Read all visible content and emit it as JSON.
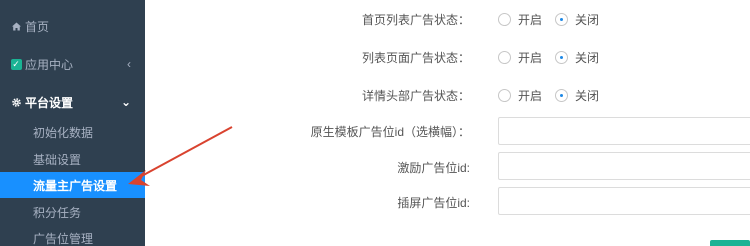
{
  "sidebar": {
    "home": "首页",
    "app_center": "应用中心",
    "platform_settings": "平台设置",
    "sub_items": [
      "初始化数据",
      "基础设置",
      "流量主广告设置",
      "积分任务",
      "广告位管理"
    ]
  },
  "form": {
    "rows": [
      {
        "label": "首页列表广告状态：",
        "options": [
          "开启",
          "关闭"
        ],
        "selected": "关闭"
      },
      {
        "label": "列表页面广告状态：",
        "options": [
          "开启",
          "关闭"
        ],
        "selected": "关闭"
      },
      {
        "label": "详情头部广告状态：",
        "options": [
          "开启",
          "关闭"
        ],
        "selected": "关闭"
      }
    ],
    "inputs": [
      {
        "label": "原生模板广告位id（选横幅）：",
        "value": ""
      },
      {
        "label": "激励广告位id:",
        "value": ""
      },
      {
        "label": "插屏广告位id:",
        "value": ""
      }
    ]
  },
  "colors": {
    "sidebar_bg": "#2f4050",
    "active_item": "#1890ff",
    "accent_green": "#1ab394",
    "annotation_arrow": "#d9432f"
  },
  "icons": [
    "home-icon",
    "check-icon",
    "chevron-left-icon",
    "gear-icon",
    "chevron-down-icon"
  ]
}
